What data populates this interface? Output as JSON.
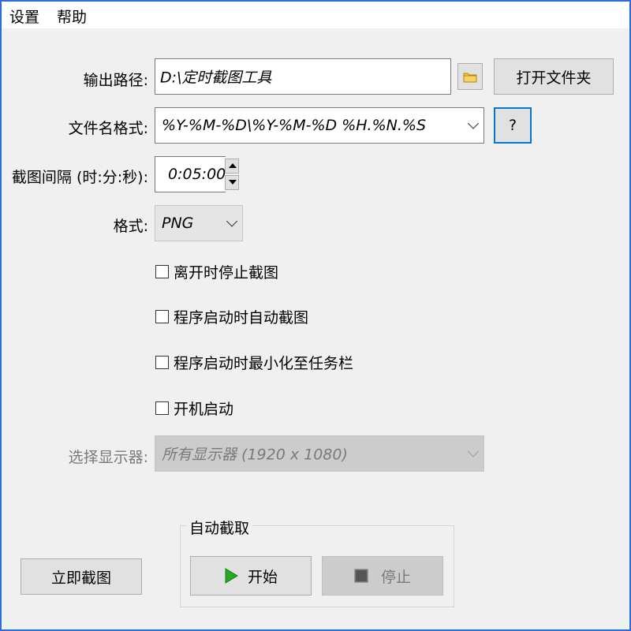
{
  "menu": {
    "settings": "设置",
    "help": "帮助"
  },
  "output_path": {
    "label": "输出路径:",
    "value": "D:\\定时截图工具",
    "open_folder_label": "打开文件夹"
  },
  "filename_format": {
    "label": "文件名格式:",
    "value": "%Y-%M-%D\\%Y-%M-%D %H.%N.%S",
    "help_label": "?"
  },
  "interval": {
    "label": "截图间隔 (时:分:秒):",
    "value": "0:05:00"
  },
  "format": {
    "label": "格式:",
    "value": "PNG"
  },
  "options": {
    "stop_on_leave": "离开时停止截图",
    "auto_capture_on_start": "程序启动时自动截图",
    "minimize_on_start": "程序启动时最小化至任务栏",
    "start_on_boot": "开机启动"
  },
  "monitor": {
    "label": "选择显示器:",
    "value": "所有显示器 (1920 x 1080)"
  },
  "capture_now_label": "立即截图",
  "auto_capture": {
    "title": "自动截取",
    "start_label": "开始",
    "stop_label": "停止"
  },
  "colors": {
    "accent": "#0078d7",
    "start_icon": "#22aa22",
    "folder_icon": "#f2c94c"
  }
}
